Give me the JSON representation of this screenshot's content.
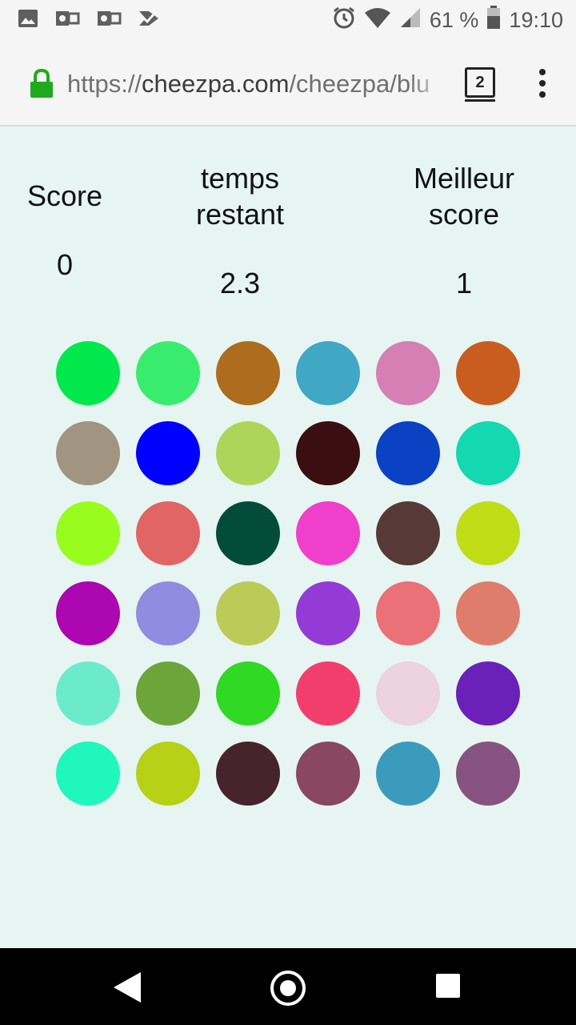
{
  "status_bar": {
    "battery_percent": "61 %",
    "time": "19:10",
    "icons": [
      "image-icon",
      "outlook-icon",
      "outlook-icon",
      "check-icon",
      "alarm-icon",
      "wifi-icon",
      "signal-icon",
      "battery-icon"
    ]
  },
  "browser": {
    "url_protocol": "https://",
    "url_host": "cheezpa.com",
    "url_path": "/cheezpa/blu",
    "tab_count": "2"
  },
  "game": {
    "score_label": "Score",
    "time_label_line1": "temps",
    "time_label_line2": "restant",
    "best_label_line1": "Meilleur",
    "best_label_line2": "score",
    "score_value": "0",
    "time_value": "2.3",
    "best_value": "1",
    "circles": [
      [
        "#00e84b",
        "#39ec6e",
        "#ad6c1e",
        "#40a7c4",
        "#d57fb4",
        "#c95d1f"
      ],
      [
        "#a19480",
        "#0000ff",
        "#add55a",
        "#3b0e11",
        "#0b41c3",
        "#13d8b0"
      ],
      [
        "#99fc1f",
        "#e26565",
        "#044c3a",
        "#f03fca",
        "#573a38",
        "#c0de18"
      ],
      [
        "#ac07b0",
        "#908cdf",
        "#bbcb57",
        "#953bd5",
        "#ea7178",
        "#df7d6d"
      ],
      [
        "#6cebcb",
        "#6ca53a",
        "#30d924",
        "#f23e6d",
        "#ecd3dd",
        "#6a20b9"
      ],
      [
        "#20f7bb",
        "#b6d116",
        "#47232c",
        "#8a4761",
        "#3a9bbc",
        "#875380"
      ]
    ]
  }
}
